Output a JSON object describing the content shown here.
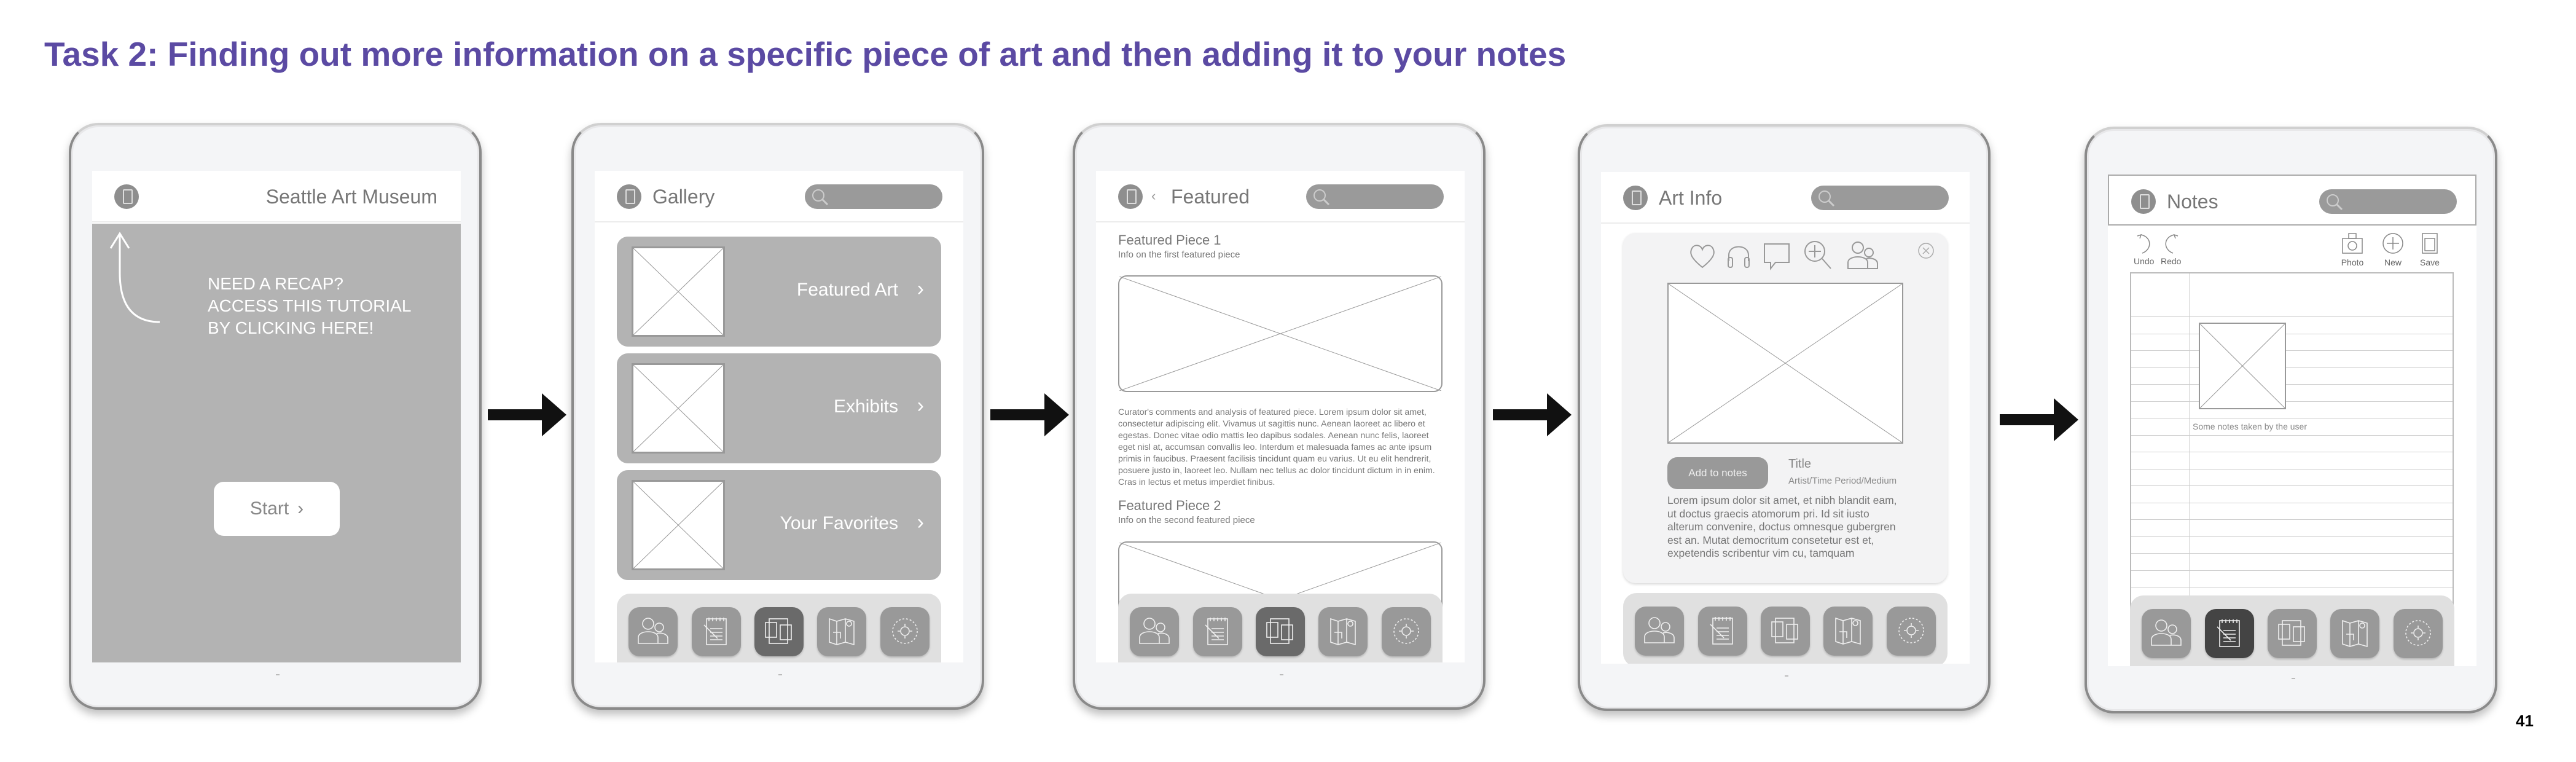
{
  "title": "Task 2: Finding out more information on a specific piece of art and then adding it to your notes",
  "page_number": "41",
  "colors": {
    "title": "#5b4aa3",
    "panel_gray": "#b3b3b3",
    "pill_gray": "#9a9a9a",
    "active_tab": "#6a6a6a",
    "selected_tab": "#444444"
  },
  "dock_icons": [
    "people-icon",
    "notepad-icon",
    "gallery-icon",
    "map-icon",
    "settings-icon"
  ],
  "screen1": {
    "header_title": "Seattle Art Museum",
    "recap_lines": [
      "NEED A RECAP?",
      "ACCESS THIS TUTORIAL",
      "BY CLICKING HERE!"
    ],
    "start_label": "Start"
  },
  "screen2": {
    "header_title": "Gallery",
    "cards": [
      "Featured Art",
      "Exhibits",
      "Your Favorites"
    ]
  },
  "screen3": {
    "header_title": "Featured",
    "piece1_title": "Featured Piece 1",
    "piece1_sub": "Info on the first featured piece",
    "piece1_text": "Curator's comments and analysis of featured piece. Lorem ipsum dolor sit amet, consectetur adipiscing elit. Vivamus ut sagittis nunc. Aenean laoreet ac libero et egestas. Donec vitae odio mattis leo dapibus sodales. Aenean nunc felis, laoreet eget nisl at, accumsan convallis leo. Interdum et malesuada fames ac ante ipsum primis in faucibus. Praesent facilisis tincidunt quam eu varius. Ut eu elit hendrerit, posuere justo in, laoreet leo. Nullam nec tellus ac dolor tincidunt dictum in in enim. Cras in lectus et metus imperdiet finibus.",
    "piece2_title": "Featured Piece 2",
    "piece2_sub": "Info on the second featured piece"
  },
  "screen4": {
    "header_title": "Art Info",
    "add_to_notes": "Add to notes",
    "art_title": "Title",
    "art_meta": "Artist/Time Period/Medium",
    "description": "Lorem ipsum dolor sit amet, et nibh blandit eam, ut doctus graecis atomorum pri. Id sit iusto alterum convenire, doctus omnesque gubergren est an. Mutat democritum consetetur est et, expetendis scribentur vim cu, tamquam",
    "action_icons": [
      "heart-icon",
      "headphones-icon",
      "comment-icon",
      "zoom-in-icon",
      "people-icon",
      "close-icon"
    ]
  },
  "screen5": {
    "header_title": "Notes",
    "undo": "Undo",
    "redo": "Redo",
    "photo": "Photo",
    "new": "New",
    "save": "Save",
    "note_text": "Some notes taken by the user"
  }
}
